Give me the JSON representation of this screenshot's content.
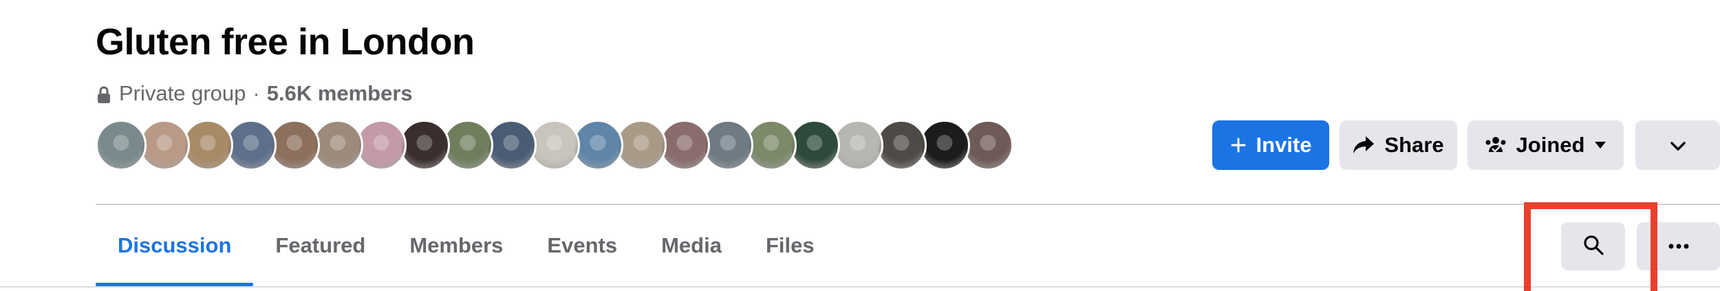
{
  "group": {
    "title": "Gluten free in London",
    "privacy": "Private group",
    "separator": "·",
    "members": "5.6K members",
    "lock_icon": "lock-icon"
  },
  "avatars": [
    {
      "color": "#7a8a8c"
    },
    {
      "color": "#b89a86"
    },
    {
      "color": "#a88a66"
    },
    {
      "color": "#5d6f8a"
    },
    {
      "color": "#8c6f5c"
    },
    {
      "color": "#9c8a7a"
    },
    {
      "color": "#c49aa6"
    },
    {
      "color": "#3a2e2e"
    },
    {
      "color": "#6f7f5e"
    },
    {
      "color": "#4a5c74"
    },
    {
      "color": "#c9c4bc"
    },
    {
      "color": "#5f86a8"
    },
    {
      "color": "#a89a86"
    },
    {
      "color": "#8a6c6c"
    },
    {
      "color": "#6e7a84"
    },
    {
      "color": "#7c8a6a"
    },
    {
      "color": "#2e4a3a"
    },
    {
      "color": "#b8b6b2"
    },
    {
      "color": "#4e4a46"
    },
    {
      "color": "#1c1c1c"
    },
    {
      "color": "#6e5a56"
    }
  ],
  "actions": {
    "invite": "Invite",
    "share": "Share",
    "joined": "Joined",
    "invite_icon": "plus-icon",
    "share_icon": "share-arrow-icon",
    "joined_icon": "people-check-icon",
    "more_icon": "chevron-down-icon"
  },
  "tabs": [
    {
      "label": "Discussion",
      "active": true
    },
    {
      "label": "Featured",
      "active": false
    },
    {
      "label": "Members",
      "active": false
    },
    {
      "label": "Events",
      "active": false
    },
    {
      "label": "Media",
      "active": false
    },
    {
      "label": "Files",
      "active": false
    }
  ],
  "toolbar": {
    "search_icon": "search-icon",
    "more_icon": "more-horizontal-icon"
  },
  "colors": {
    "accent": "#1b74e4",
    "secondary_button": "#e4e6eb",
    "text_primary": "#050505",
    "text_secondary": "#65676b",
    "highlight": "#e8402c"
  }
}
